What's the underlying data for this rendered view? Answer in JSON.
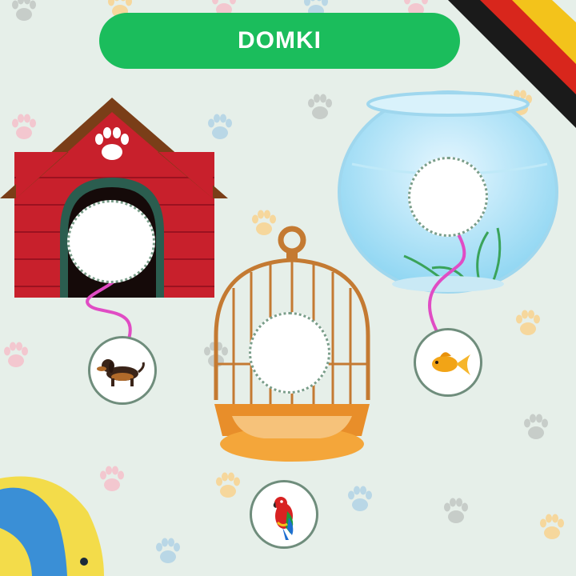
{
  "title": "DOMKI",
  "colors": {
    "background": "#e6efe9",
    "title_pill": "#1bbd5c",
    "title_text": "#ffffff",
    "arrow": "#e04cc4",
    "paw_prints": [
      "#f3c7cf",
      "#f6d79c",
      "#c7cdc9",
      "#b9d7e6"
    ],
    "flag": [
      "#1a1a1a",
      "#d8261c",
      "#f3c31b"
    ]
  },
  "flag": "germany-flag",
  "houses": [
    {
      "name": "doghouse",
      "drop_target": "doghouse-drop-slot"
    },
    {
      "name": "birdcage",
      "drop_target": "birdcage-drop-slot"
    },
    {
      "name": "fishbowl",
      "drop_target": "fishbowl-drop-slot"
    }
  ],
  "animals": [
    {
      "name": "dachshund",
      "icon": "dachshund-icon",
      "target": "doghouse"
    },
    {
      "name": "parrot",
      "icon": "parrot-icon",
      "target": "birdcage"
    },
    {
      "name": "goldfish",
      "icon": "goldfish-icon",
      "target": "fishbowl"
    }
  ],
  "decorations": [
    "paw-print-icon",
    "tropical-fish-icon"
  ]
}
